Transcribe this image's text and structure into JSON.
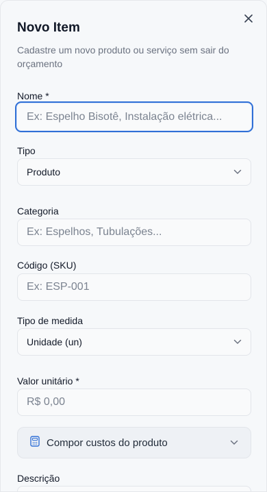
{
  "dialog": {
    "title": "Novo Item",
    "subtitle": "Cadastre um novo produto ou serviço sem sair do orçamento"
  },
  "form": {
    "name_label": "Nome *",
    "name_placeholder": "Ex: Espelho Bisotê, Instalação elétrica...",
    "type_label": "Tipo",
    "type_value": "Produto",
    "category_label": "Categoria",
    "category_placeholder": "Ex: Espelhos, Tubulações...",
    "sku_label": "Código (SKU)",
    "sku_placeholder": "Ex: ESP-001",
    "measure_label": "Tipo de medida",
    "measure_value": "Unidade (un)",
    "unit_price_label": "Valor unitário *",
    "unit_price_placeholder": "R$ 0,00",
    "compose_costs_label": "Compor custos do produto",
    "description_label": "Descrição"
  },
  "icons": {
    "close": "close-icon",
    "chevron": "chevron-down-icon",
    "calculator": "calculator-icon"
  },
  "colors": {
    "focus_border": "#2f6fd6",
    "background": "#f6f8fa",
    "muted_text": "#6b7280"
  }
}
